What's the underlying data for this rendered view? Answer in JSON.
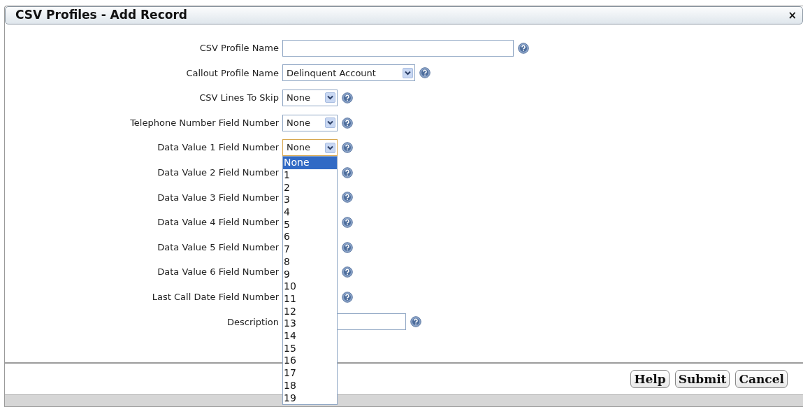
{
  "window": {
    "title": "CSV Profiles - Add Record",
    "close": "×"
  },
  "rows": [
    {
      "label": "CSV Profile Name",
      "field": {
        "kind": "text"
      }
    },
    {
      "label": "Callout Profile Name",
      "field": {
        "kind": "select",
        "value": "Delinquent Account"
      }
    },
    {
      "label": "CSV Lines To Skip",
      "field": {
        "kind": "select",
        "value": "None"
      }
    },
    {
      "label": "Telephone Number Field Number",
      "field": {
        "kind": "select",
        "value": "None"
      }
    },
    {
      "label": "Data Value 1 Field Number",
      "field": {
        "kind": "select",
        "value": "None",
        "focused": true,
        "open": true,
        "options": [
          {
            "label": "None",
            "selected": true
          },
          {
            "label": "1",
            "selected": false
          },
          {
            "label": "2",
            "selected": false
          },
          {
            "label": "3",
            "selected": false
          },
          {
            "label": "4",
            "selected": false
          },
          {
            "label": "5",
            "selected": false
          },
          {
            "label": "6",
            "selected": false
          },
          {
            "label": "7",
            "selected": false
          },
          {
            "label": "8",
            "selected": false
          },
          {
            "label": "9",
            "selected": false
          },
          {
            "label": "10",
            "selected": false
          },
          {
            "label": "11",
            "selected": false
          },
          {
            "label": "12",
            "selected": false
          },
          {
            "label": "13",
            "selected": false
          },
          {
            "label": "14",
            "selected": false
          },
          {
            "label": "15",
            "selected": false
          },
          {
            "label": "16",
            "selected": false
          },
          {
            "label": "17",
            "selected": false
          },
          {
            "label": "18",
            "selected": false
          },
          {
            "label": "19",
            "selected": false
          }
        ]
      }
    },
    {
      "label": "Data Value 2 Field Number",
      "field": {
        "kind": "select"
      }
    },
    {
      "label": "Data Value 3 Field Number",
      "field": {
        "kind": "select"
      }
    },
    {
      "label": "Data Value 4 Field Number",
      "field": {
        "kind": "select"
      }
    },
    {
      "label": "Data Value 5 Field Number",
      "field": {
        "kind": "select"
      }
    },
    {
      "label": "Data Value 6 Field Number",
      "field": {
        "kind": "select"
      }
    },
    {
      "label": "Last Call Date Field Number",
      "field": {
        "kind": "select"
      }
    },
    {
      "label": "Description",
      "field": {
        "kind": "text"
      }
    }
  ],
  "buttons": [
    "Help",
    "Submit",
    "Cancel"
  ]
}
